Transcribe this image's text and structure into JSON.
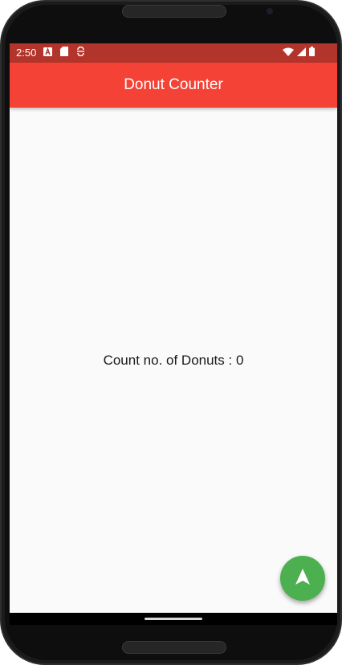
{
  "status_bar": {
    "time": "2:50",
    "background": "#b3342b",
    "left_icons": [
      "a-notification-icon",
      "sd-card-icon",
      "sync-icon"
    ],
    "right_icons": [
      "wifi-icon",
      "signal-icon",
      "battery-icon"
    ]
  },
  "app_bar": {
    "title": "Donut Counter",
    "background": "#f44336"
  },
  "main": {
    "count_text": "Count no. of Donuts : 0",
    "background": "#fafafa"
  },
  "fab": {
    "icon": "navigation-arrow-icon",
    "background": "#4caf50"
  }
}
